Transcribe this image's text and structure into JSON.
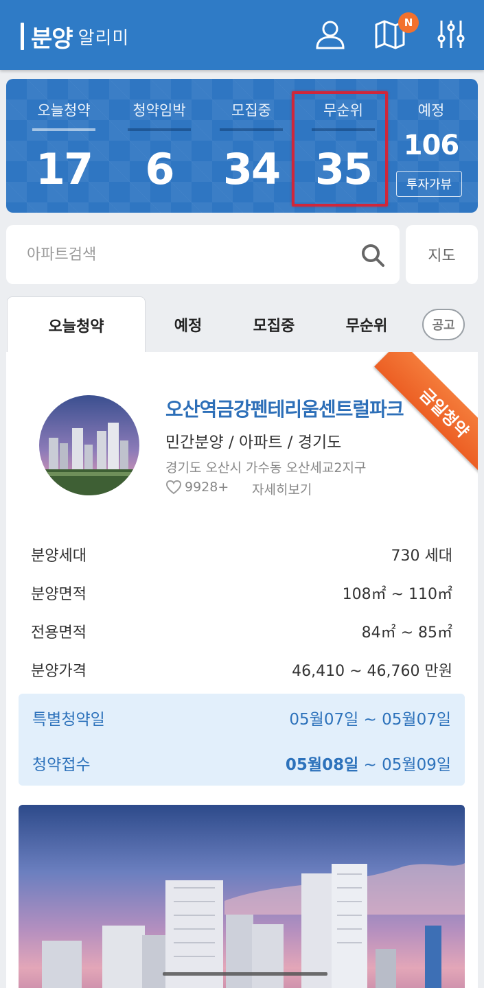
{
  "header": {
    "logo_main": "분양",
    "logo_sub": "알리미",
    "badge": "N",
    "icons": [
      "user-icon",
      "map-icon",
      "settings-sliders-icon"
    ]
  },
  "stats": {
    "items": [
      {
        "label": "오늘청약",
        "value": "17"
      },
      {
        "label": "청약임박",
        "value": "6"
      },
      {
        "label": "모집중",
        "value": "34"
      },
      {
        "label": "무순위",
        "value": "35"
      },
      {
        "label": "예정",
        "value": "106"
      }
    ],
    "invest_review": "투자가뷰"
  },
  "search": {
    "placeholder": "아파트검색",
    "map_button": "지도"
  },
  "tabs": [
    {
      "label": "오늘청약",
      "active": true
    },
    {
      "label": "예정"
    },
    {
      "label": "모집중"
    },
    {
      "label": "무순위"
    }
  ],
  "notice_button": "공고",
  "listing": {
    "ribbon": "금일청약",
    "title": "오산역금강펜테리움센트럴파크",
    "type": "민간분양 / 아파트 / 경기도",
    "address": "경기도 오산시 가수동 오산세교2지구",
    "likes": "9928+",
    "detail_link": "자세히보기",
    "info": [
      {
        "key": "분양세대",
        "value": "730 세대"
      },
      {
        "key": "분양면적",
        "value": "108㎡ ~ 110㎡"
      },
      {
        "key": "전용면적",
        "value": "84㎡ ~ 85㎡"
      },
      {
        "key": "분양가격",
        "value": "46,410 ~ 46,760 만원"
      }
    ],
    "special_date": {
      "key": "특별청약일",
      "value": "05월07일 ~ 05월07일"
    },
    "application": {
      "key": "청약접수",
      "value_bold": "05월08일",
      "value_rest": " ~ 05월09일"
    }
  },
  "colors": {
    "header_blue": "#2f7bc6",
    "stats_blue": "#2f76c2",
    "title_blue": "#2d6fb8",
    "ribbon_orange": "#ec5f24",
    "highlight_red": "#d0263a",
    "date_bg": "#e2effb"
  }
}
